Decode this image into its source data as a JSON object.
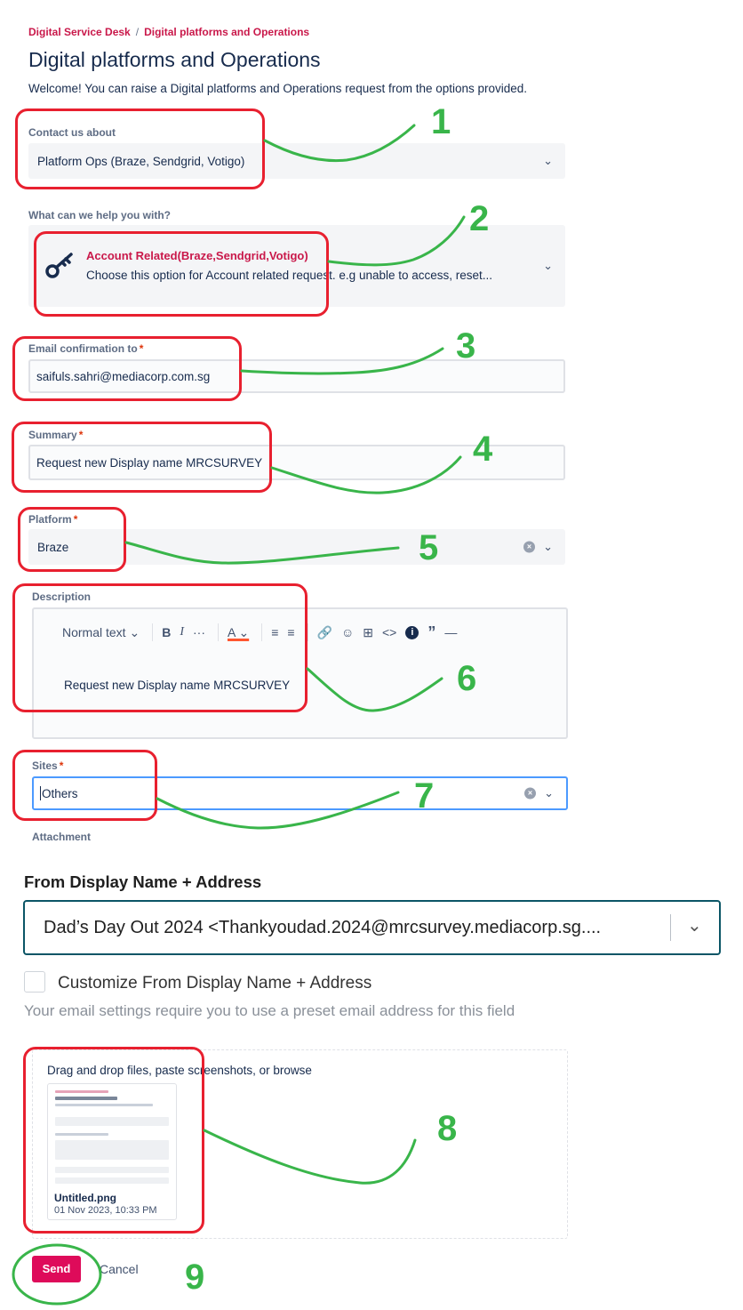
{
  "breadcrumb": {
    "root": "Digital Service Desk",
    "separator": "/",
    "current": "Digital platforms and Operations"
  },
  "page": {
    "title": "Digital platforms and Operations",
    "welcome": "Welcome! You can raise a Digital platforms and Operations request from the options provided."
  },
  "contact": {
    "label": "Contact us about",
    "value": "Platform Ops (Braze, Sendgrid, Votigo)"
  },
  "help": {
    "label": "What can we help you with?",
    "option_title": "Account Related(Braze,Sendgrid,Votigo)",
    "option_desc": "Choose this option for Account related request. e.g unable to access, reset..."
  },
  "email": {
    "label": "Email confirmation to",
    "value": "saifuls.sahri@mediacorp.com.sg"
  },
  "summary": {
    "label": "Summary",
    "value": "Request new Display name MRCSURVEY"
  },
  "platform": {
    "label": "Platform",
    "value": "Braze"
  },
  "description": {
    "label": "Description",
    "text_style": "Normal text",
    "body": "Request new Display name MRCSURVEY"
  },
  "sites": {
    "label": "Sites",
    "value": "Others"
  },
  "attachment": {
    "label": "Attachment"
  },
  "pasted": {
    "heading": "From Display Name + Address",
    "select_value": "Dad’s Day Out 2024 <Thankyoudad.2024@mrcsurvey.mediacorp.sg....",
    "checkbox_label": "Customize From Display Name + Address",
    "hint": "Your email settings require you to use a preset email address for this field"
  },
  "dropzone": {
    "text": "Drag and drop files, paste screenshots, or browse",
    "file_name": "Untitled.png",
    "file_date": "01 Nov 2023, 10:33 PM"
  },
  "actions": {
    "send": "Send",
    "cancel": "Cancel"
  },
  "annotations": [
    "1",
    "2",
    "3",
    "4",
    "5",
    "6",
    "7",
    "8",
    "9"
  ],
  "colors": {
    "accent": "#c9184a",
    "annotation_red": "#e8202f",
    "annotation_green": "#39b54a",
    "send_bg": "#de0b5a"
  }
}
